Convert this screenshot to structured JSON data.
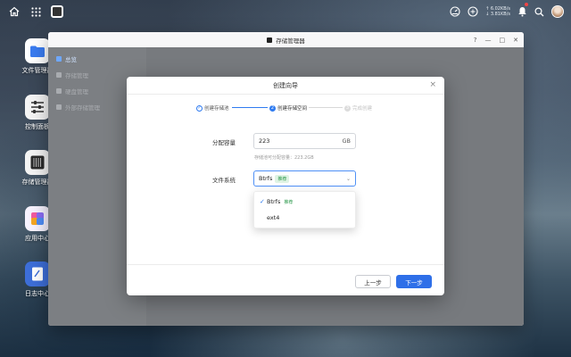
{
  "topbar": {
    "net_up": "↑ 6.02KB/s",
    "net_down": "↓ 3.81KB/s",
    "icons": [
      "home-icon",
      "apps-grid-icon",
      "app-window-icon",
      "dashboard-icon",
      "network-speed-icon",
      "bell-icon",
      "search-icon",
      "avatar"
    ]
  },
  "desktop": [
    {
      "label": "文件管理器",
      "icon": "folder-icon"
    },
    {
      "label": "控制面板",
      "icon": "sliders-icon"
    },
    {
      "label": "存储管理器",
      "icon": "storage-icon"
    },
    {
      "label": "应用中心",
      "icon": "app-center-icon"
    },
    {
      "label": "日志中心",
      "icon": "log-icon"
    }
  ],
  "window": {
    "title": "存储管理器",
    "controls": {
      "help": "?",
      "minimize": "—",
      "maximize": "□",
      "close": "✕"
    },
    "sidebar": [
      {
        "label": "总览",
        "active": true
      },
      {
        "label": "存储管理",
        "active": false
      },
      {
        "label": "硬盘管理",
        "active": false
      },
      {
        "label": "外部存储管理",
        "active": false
      }
    ]
  },
  "dialog": {
    "title": "创建向导",
    "close": "×",
    "steps": [
      {
        "label": "创建存储池",
        "state": "done",
        "marker": "✓"
      },
      {
        "label": "创建存储空间",
        "state": "current",
        "marker": "2"
      },
      {
        "label": "完成创建",
        "state": "todo",
        "marker": "3"
      }
    ],
    "capacity": {
      "label": "分配容量",
      "value": "223",
      "unit": "GB",
      "hint": "存储池可分配容量：223.2GB"
    },
    "filesystem": {
      "label": "文件系统",
      "selected": "Btrfs",
      "selected_tag": "推荐",
      "options": [
        {
          "label": "Btrfs",
          "tag": "推荐",
          "checked": true
        },
        {
          "label": "ext4",
          "tag": "",
          "checked": false
        }
      ]
    },
    "buttons": {
      "prev": "上一步",
      "next": "下一步"
    }
  },
  "colors": {
    "accent": "#2e6fe8",
    "recommend_green": "#2e9a4d",
    "notification_dot": "#f04545"
  }
}
